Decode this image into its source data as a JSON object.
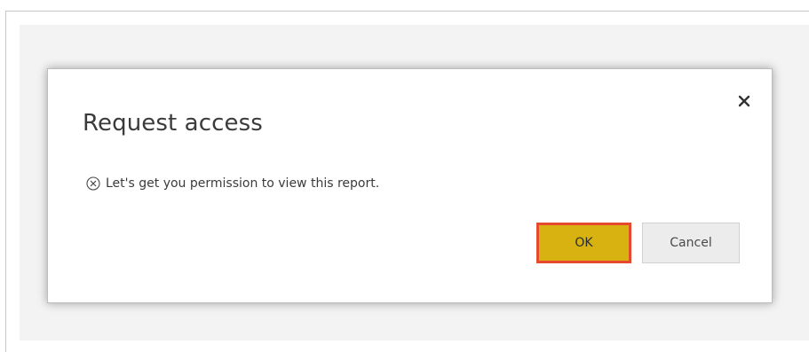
{
  "dialog": {
    "title": "Request access",
    "message": "Let's get you permission to view this report.",
    "ok_label": "OK",
    "cancel_label": "Cancel"
  },
  "icons": {
    "close": "close-icon",
    "message": "x-circle-icon"
  },
  "colors": {
    "ok_button_bg": "#d8b210",
    "ok_button_highlight": "#e54a2f",
    "cancel_button_bg": "#ececec",
    "text": "#3b3b3b"
  }
}
